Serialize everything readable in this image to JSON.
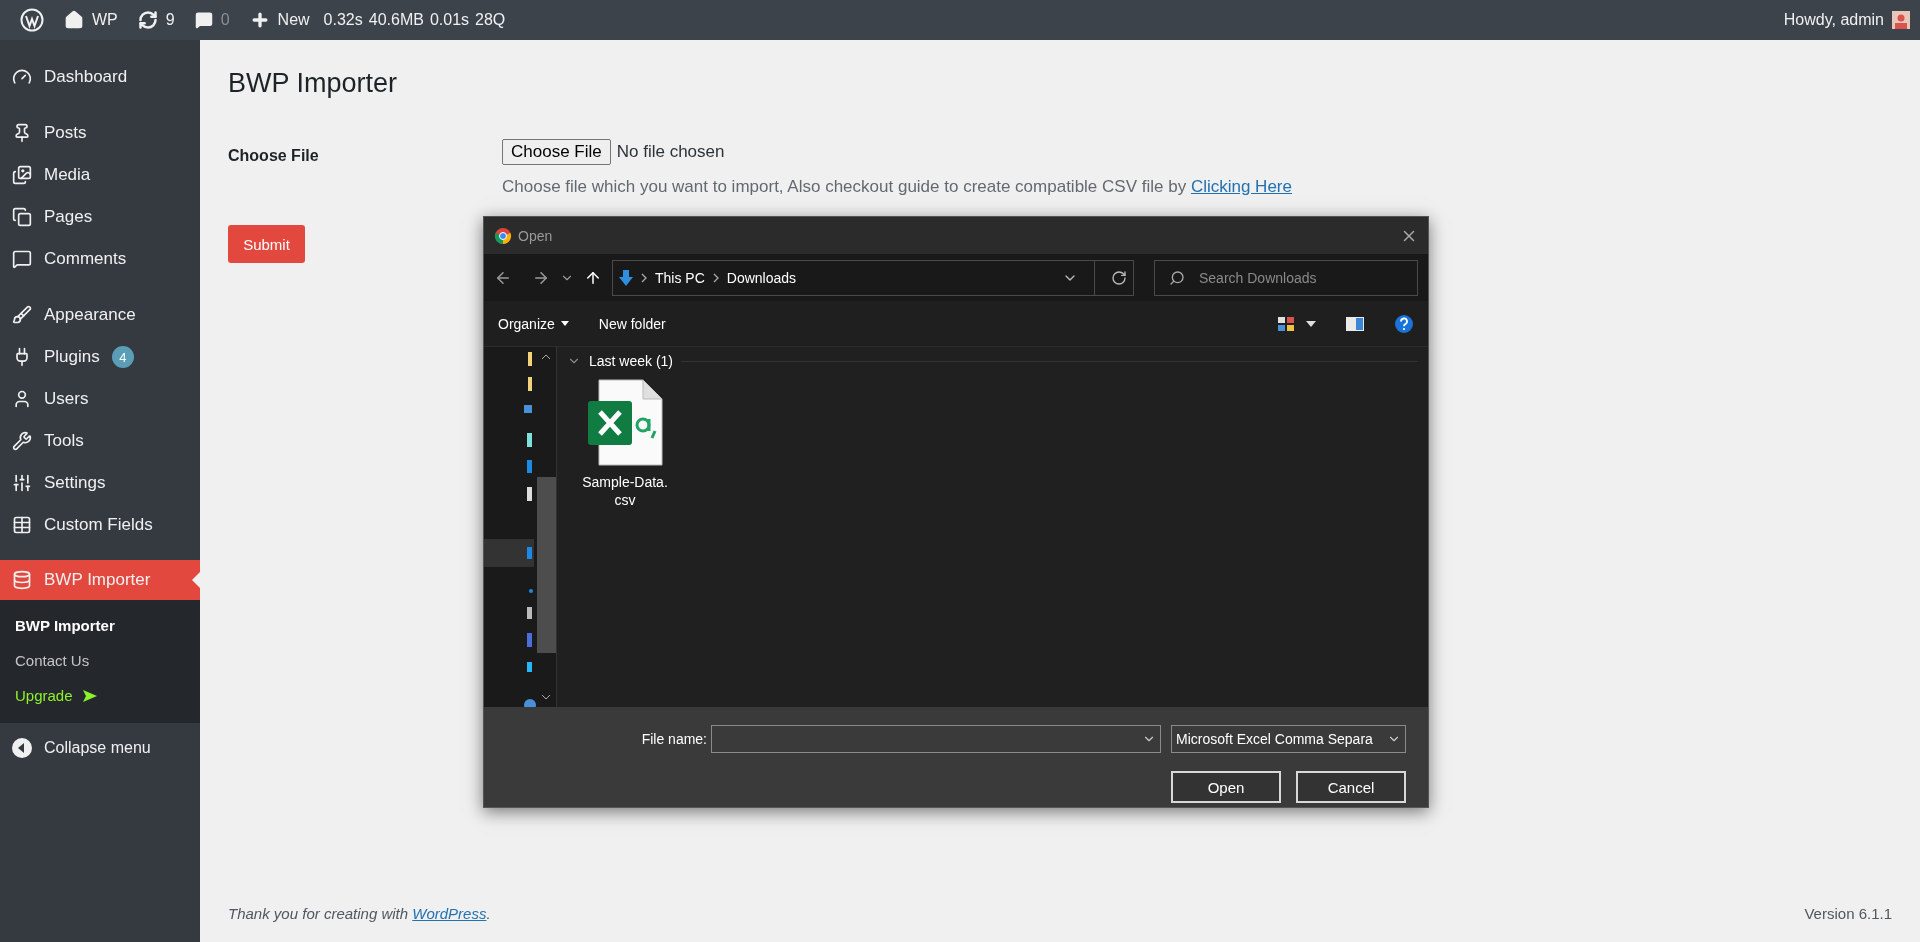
{
  "admin_bar": {
    "site": "WP",
    "updates": "9",
    "comments": "0",
    "new": "New",
    "stats": [
      "0.32s",
      "40.6MB",
      "0.01s",
      "28Q"
    ],
    "greeting": "Howdy, admin"
  },
  "sidebar": {
    "groups": [
      {
        "items": [
          {
            "label": "Dashboard",
            "selected": false
          }
        ]
      },
      {
        "items": [
          {
            "label": "Posts",
            "selected": false
          },
          {
            "label": "Media",
            "selected": false
          },
          {
            "label": "Pages",
            "selected": false
          },
          {
            "label": "Comments",
            "selected": false
          }
        ]
      },
      {
        "items": [
          {
            "label": "Appearance",
            "selected": false
          },
          {
            "label": "Plugins",
            "selected": false,
            "badge": "4"
          },
          {
            "label": "Users",
            "selected": false
          },
          {
            "label": "Tools",
            "selected": false
          },
          {
            "label": "Settings",
            "selected": false
          },
          {
            "label": "Custom Fields",
            "selected": false
          }
        ]
      },
      {
        "items": [
          {
            "label": "BWP Importer",
            "selected": true
          }
        ]
      }
    ],
    "submenu": [
      {
        "label": "BWP Importer",
        "selected": true,
        "kind": "link"
      },
      {
        "label": "Contact Us",
        "selected": false,
        "kind": "link"
      },
      {
        "label": "Upgrade",
        "selected": false,
        "kind": "upgrade"
      }
    ],
    "collapse": "Collapse menu"
  },
  "page": {
    "title": "BWP Importer",
    "field_label": "Choose File",
    "file_button": "Choose File",
    "file_status": "No file chosen",
    "description": "Choose file which you want to import, Also checkout guide to create compatible CSV file by",
    "link": "Clicking Here",
    "submit": "Submit"
  },
  "dialog": {
    "title": "Open",
    "path": [
      "This PC",
      "Downloads"
    ],
    "search_placeholder": "Search Downloads",
    "organize": "Organize",
    "new_folder": "New folder",
    "group": "Last week (1)",
    "files": [
      {
        "name": "Sample-Data.\ncsv"
      }
    ],
    "file_name_label": "File name:",
    "file_type": "Microsoft Excel Comma Separa",
    "open": "Open",
    "cancel": "Cancel"
  },
  "footer": {
    "thanks": "Thank you for creating with",
    "link": "WordPress",
    "after": ".",
    "version": "Version 6.1.1"
  }
}
